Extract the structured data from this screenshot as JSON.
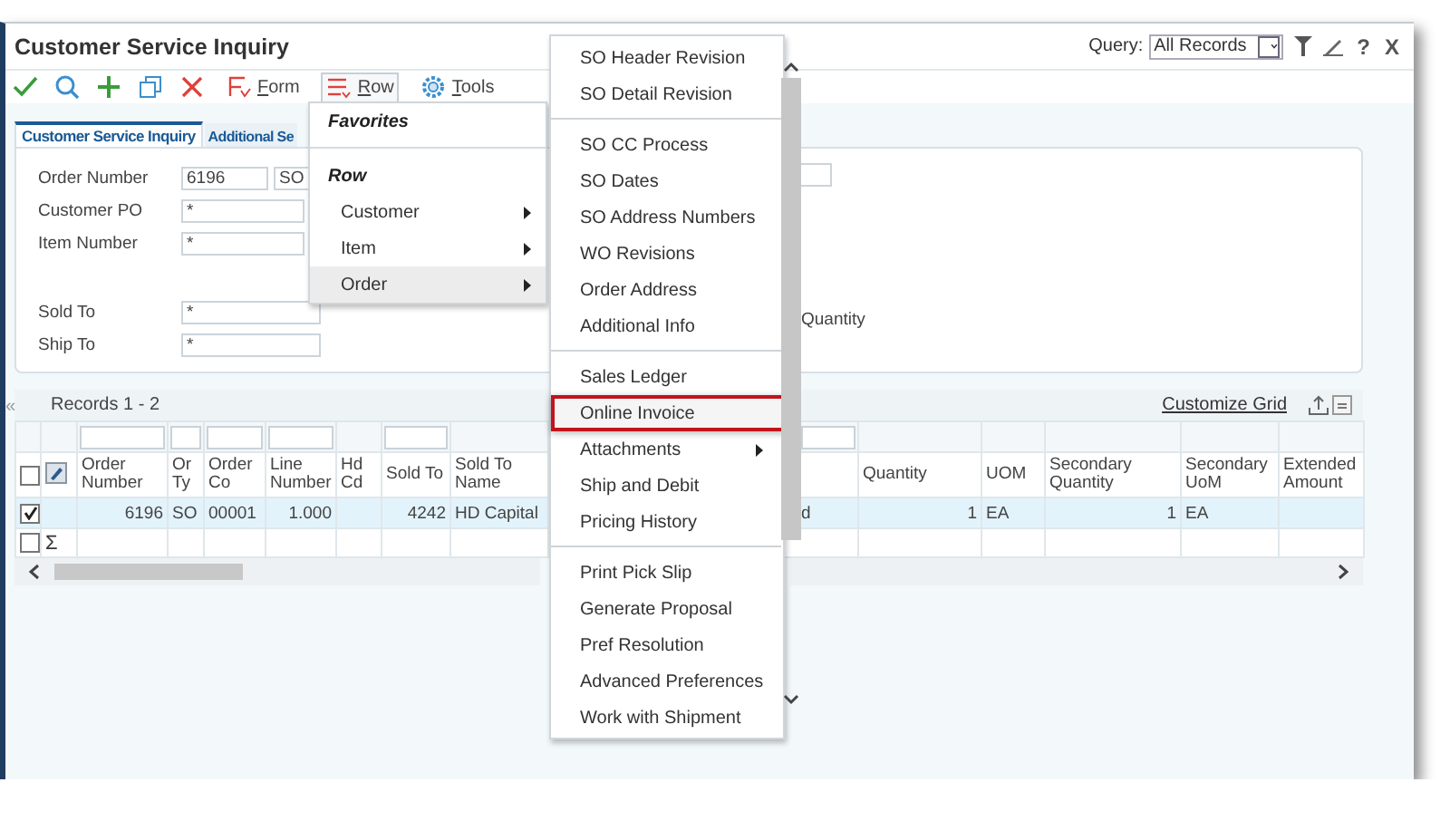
{
  "window": {
    "title": "Customer Service Inquiry"
  },
  "query": {
    "label": "Query:",
    "value": "All Records"
  },
  "title_actions": [
    "?",
    "X"
  ],
  "toolbar": {
    "buttons": [
      {
        "label": "Form",
        "selected": false
      },
      {
        "label": "Row",
        "selected": true
      },
      {
        "label": "Tools",
        "selected": false
      }
    ]
  },
  "tabs": [
    {
      "label": "Customer Service Inquiry",
      "selected": true
    },
    {
      "label": "Additional Se",
      "selected": false
    }
  ],
  "form": {
    "fields": [
      {
        "label": "Order Number",
        "values": [
          "6196",
          "SO"
        ]
      },
      {
        "label": "Customer PO",
        "values": [
          "*"
        ]
      },
      {
        "label": "Item Number",
        "values": [
          "*"
        ]
      },
      {
        "label": "Sold To",
        "values": [
          "*"
        ]
      },
      {
        "label": "Ship To",
        "values": [
          "*"
        ]
      }
    ],
    "column_2_label": "Quantity"
  },
  "grid": {
    "collapse_symbol": "«",
    "records": "Records 1 - 2",
    "customize_link": "Customize Grid",
    "header_checked": false,
    "columns": [
      {
        "label": "Order Number",
        "filter": true
      },
      {
        "label": "Or Ty",
        "filter": true
      },
      {
        "label": "Order Co",
        "filter": true
      },
      {
        "label": "Line Number",
        "filter": true
      },
      {
        "label": "Hd Cd",
        "filter": false
      },
      {
        "label": "Sold To",
        "filter": true
      },
      {
        "label": "Sold To Name",
        "filter": false
      },
      {},
      {
        "filter": true
      },
      {
        "label": "Quantity",
        "filter": false
      },
      {
        "label": "UOM",
        "filter": false
      },
      {
        "label": "Secondary Quantity",
        "filter": false
      },
      {
        "label": "Secondary UoM",
        "filter": false
      },
      {
        "label": "Extended Amount",
        "filter": false
      }
    ],
    "rows": [
      {
        "kind": "data",
        "checked": true,
        "selected": true,
        "cells": [
          "6196",
          "SO",
          "00001",
          "1.000",
          null,
          "4242",
          "HD Capital",
          null,
          "d",
          "1",
          "EA",
          "1",
          "EA",
          null
        ]
      },
      {
        "kind": "total",
        "checked": false,
        "selected": false,
        "symbol": "Σ"
      }
    ]
  },
  "row_menu": {
    "sections": [
      {
        "title": "Favorites"
      },
      {
        "title": "Row",
        "items": [
          {
            "label": "Customer",
            "submenu": true,
            "selected": false
          },
          {
            "label": "Item",
            "submenu": true,
            "selected": false
          },
          {
            "label": "Order",
            "submenu": true,
            "selected": true
          }
        ]
      }
    ]
  },
  "order_menu": {
    "groups": [
      {
        "items": [
          {
            "label": "SO Header Revision",
            "submenu": false,
            "selected": false
          },
          {
            "label": "SO Detail Revision",
            "submenu": false,
            "selected": false
          }
        ]
      },
      {
        "items": [
          {
            "label": "SO CC Process",
            "submenu": false,
            "selected": false
          },
          {
            "label": "SO Dates",
            "submenu": false,
            "selected": false
          },
          {
            "label": "SO Address Numbers",
            "submenu": false,
            "selected": false
          },
          {
            "label": "WO Revisions",
            "submenu": false,
            "selected": false
          },
          {
            "label": "Order Address",
            "submenu": false,
            "selected": false
          },
          {
            "label": "Additional Info",
            "submenu": false,
            "selected": false
          }
        ]
      },
      {
        "items": [
          {
            "label": "Sales Ledger",
            "submenu": false,
            "selected": false
          },
          {
            "label": "Online Invoice",
            "submenu": false,
            "selected": true
          },
          {
            "label": "Attachments",
            "submenu": true,
            "selected": false
          },
          {
            "label": "Ship and Debit",
            "submenu": false,
            "selected": false
          },
          {
            "label": "Pricing History",
            "submenu": false,
            "selected": false
          }
        ]
      },
      {
        "items": [
          {
            "label": "Print Pick Slip",
            "submenu": false,
            "selected": false
          },
          {
            "label": "Generate Proposal",
            "submenu": false,
            "selected": false
          },
          {
            "label": "Pref Resolution",
            "submenu": false,
            "selected": false
          },
          {
            "label": "Advanced Preferences",
            "submenu": false,
            "selected": false
          },
          {
            "label": "Work with Shipment",
            "submenu": false,
            "selected": false
          }
        ]
      }
    ]
  }
}
